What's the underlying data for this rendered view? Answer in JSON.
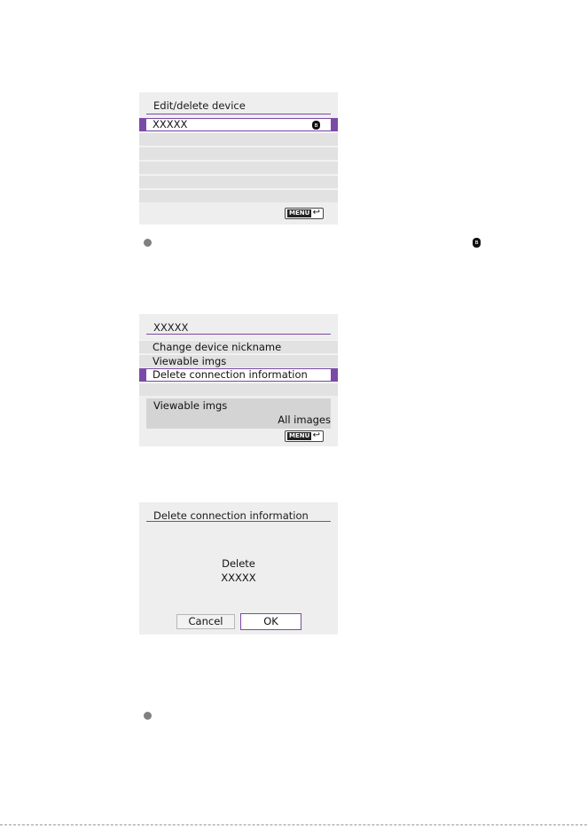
{
  "screen1": {
    "title": "Edit/delete device",
    "rows": [
      "XXXXX",
      "",
      "",
      "",
      "",
      ""
    ],
    "selected_device_label": "XXXXX",
    "bluetooth_icon": "bluetooth-icon",
    "menu_label": "MENU",
    "back_icon": "back-arrow-icon"
  },
  "screen2": {
    "title": "XXXXX",
    "items": [
      "Change device nickname",
      "Viewable imgs",
      "Delete connection information",
      ""
    ],
    "info_label": "Viewable imgs",
    "info_value": "All images",
    "menu_label": "MENU"
  },
  "screen3": {
    "title": "Delete connection information",
    "message_line1": "Delete",
    "message_line2": "XXXXX",
    "cancel_label": "Cancel",
    "ok_label": "OK"
  },
  "colors": {
    "accent": "#7a4aa6",
    "screen_bg": "#eeeeee",
    "bullet": "#808080"
  }
}
